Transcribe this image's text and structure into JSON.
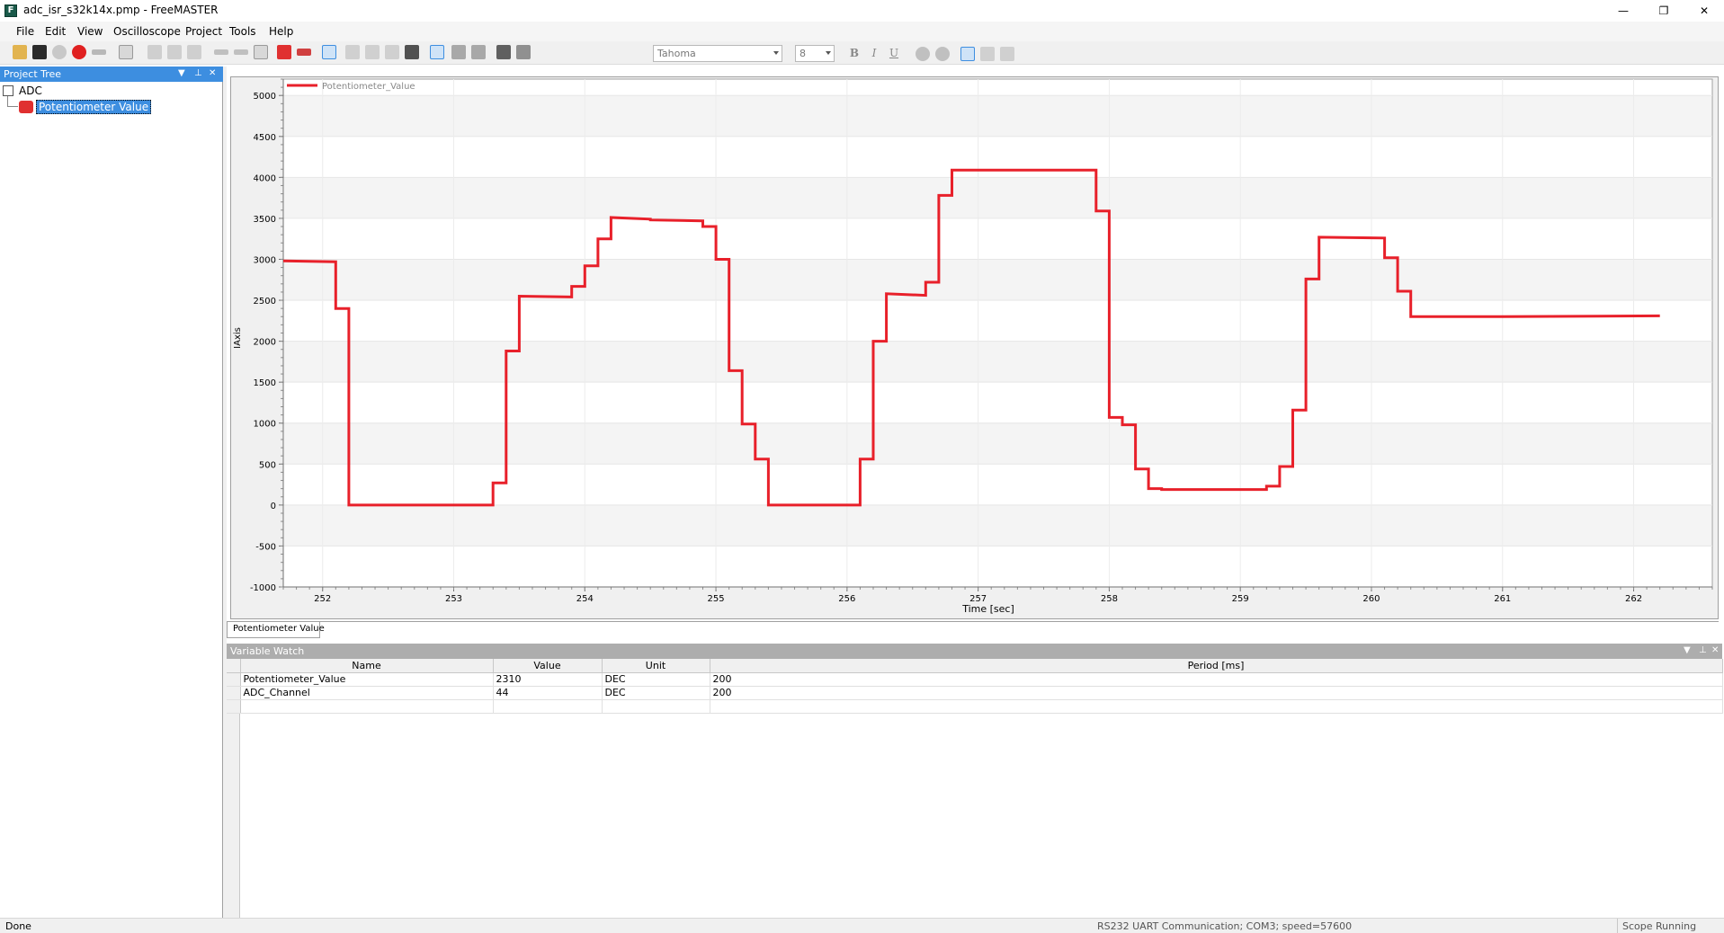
{
  "window": {
    "title": "adc_isr_s32k14x.pmp - FreeMASTER",
    "app_icon": "F",
    "minimize": "—",
    "restore": "❐",
    "close": "✕"
  },
  "menu": [
    "File",
    "Edit",
    "View",
    "Oscilloscope",
    "Project",
    "Tools",
    "Help"
  ],
  "toolbar": {
    "font_name": "Tahoma",
    "font_size": "8",
    "bold": "B",
    "italic": "I",
    "underline": "U"
  },
  "project_tree": {
    "title": "Project Tree",
    "root": "ADC",
    "selected_item": "Potentiometer Value"
  },
  "chart_tab": "Potentiometer Value",
  "chart_data": {
    "type": "line",
    "title": "",
    "xlabel": "Time [sec]",
    "ylabel": "IAxis",
    "xlim": [
      251.7,
      262.6
    ],
    "ylim": [
      -1000,
      5200
    ],
    "xticks": [
      252,
      253,
      254,
      255,
      256,
      257,
      258,
      259,
      260,
      261,
      262
    ],
    "yticks": [
      5000,
      4500,
      4000,
      3500,
      3000,
      2500,
      2000,
      1500,
      1000,
      500,
      0,
      -500,
      -1000
    ],
    "legend_position": "top-left",
    "grid": true,
    "series": [
      {
        "name": "Potentiometer_Value",
        "color": "#e8202a",
        "x": [
          251.7,
          252.1,
          252.1,
          252.2,
          252.2,
          253.3,
          253.3,
          253.4,
          253.4,
          253.5,
          253.5,
          253.9,
          253.9,
          254.0,
          254.0,
          254.1,
          254.1,
          254.2,
          254.2,
          254.5,
          254.5,
          254.9,
          254.9,
          255.0,
          255.0,
          255.1,
          255.1,
          255.2,
          255.2,
          255.3,
          255.3,
          255.4,
          255.4,
          255.5,
          255.5,
          256.1,
          256.1,
          256.2,
          256.2,
          256.3,
          256.3,
          256.6,
          256.6,
          256.7,
          256.7,
          256.8,
          256.8,
          257.9,
          257.9,
          258.0,
          258.0,
          258.1,
          258.1,
          258.2,
          258.2,
          258.3,
          258.3,
          258.4,
          258.4,
          259.2,
          259.2,
          259.3,
          259.3,
          259.4,
          259.4,
          259.5,
          259.5,
          259.6,
          259.6,
          260.1,
          260.1,
          260.2,
          260.2,
          260.3,
          260.3,
          261.0,
          262.2
        ],
        "y": [
          2980,
          2970,
          2400,
          2400,
          0,
          0,
          270,
          270,
          1880,
          1880,
          2550,
          2540,
          2670,
          2670,
          2920,
          2920,
          3250,
          3250,
          3510,
          3490,
          3480,
          3470,
          3400,
          3400,
          3000,
          3000,
          1640,
          1640,
          990,
          990,
          560,
          560,
          0,
          0,
          0,
          0,
          560,
          560,
          2000,
          2000,
          2580,
          2560,
          2720,
          2720,
          3780,
          3780,
          4090,
          4090,
          3590,
          3590,
          1070,
          1070,
          980,
          980,
          440,
          440,
          200,
          200,
          190,
          190,
          230,
          230,
          470,
          470,
          1160,
          1160,
          2760,
          2760,
          3270,
          3260,
          3020,
          3020,
          2610,
          2610,
          2300,
          2300,
          2310
        ]
      }
    ]
  },
  "variable_watch": {
    "title": "Variable Watch",
    "columns": [
      "Name",
      "Value",
      "Unit",
      "Period [ms]"
    ],
    "rows": [
      {
        "name": "Potentiometer_Value",
        "value": "2310",
        "unit": "DEC",
        "period": "200"
      },
      {
        "name": "ADC_Channel",
        "value": "44",
        "unit": "DEC",
        "period": "200"
      }
    ]
  },
  "status": {
    "left": "Done",
    "comm": "RS232 UART Communication; COM3; speed=57600",
    "right": "Scope Running"
  }
}
